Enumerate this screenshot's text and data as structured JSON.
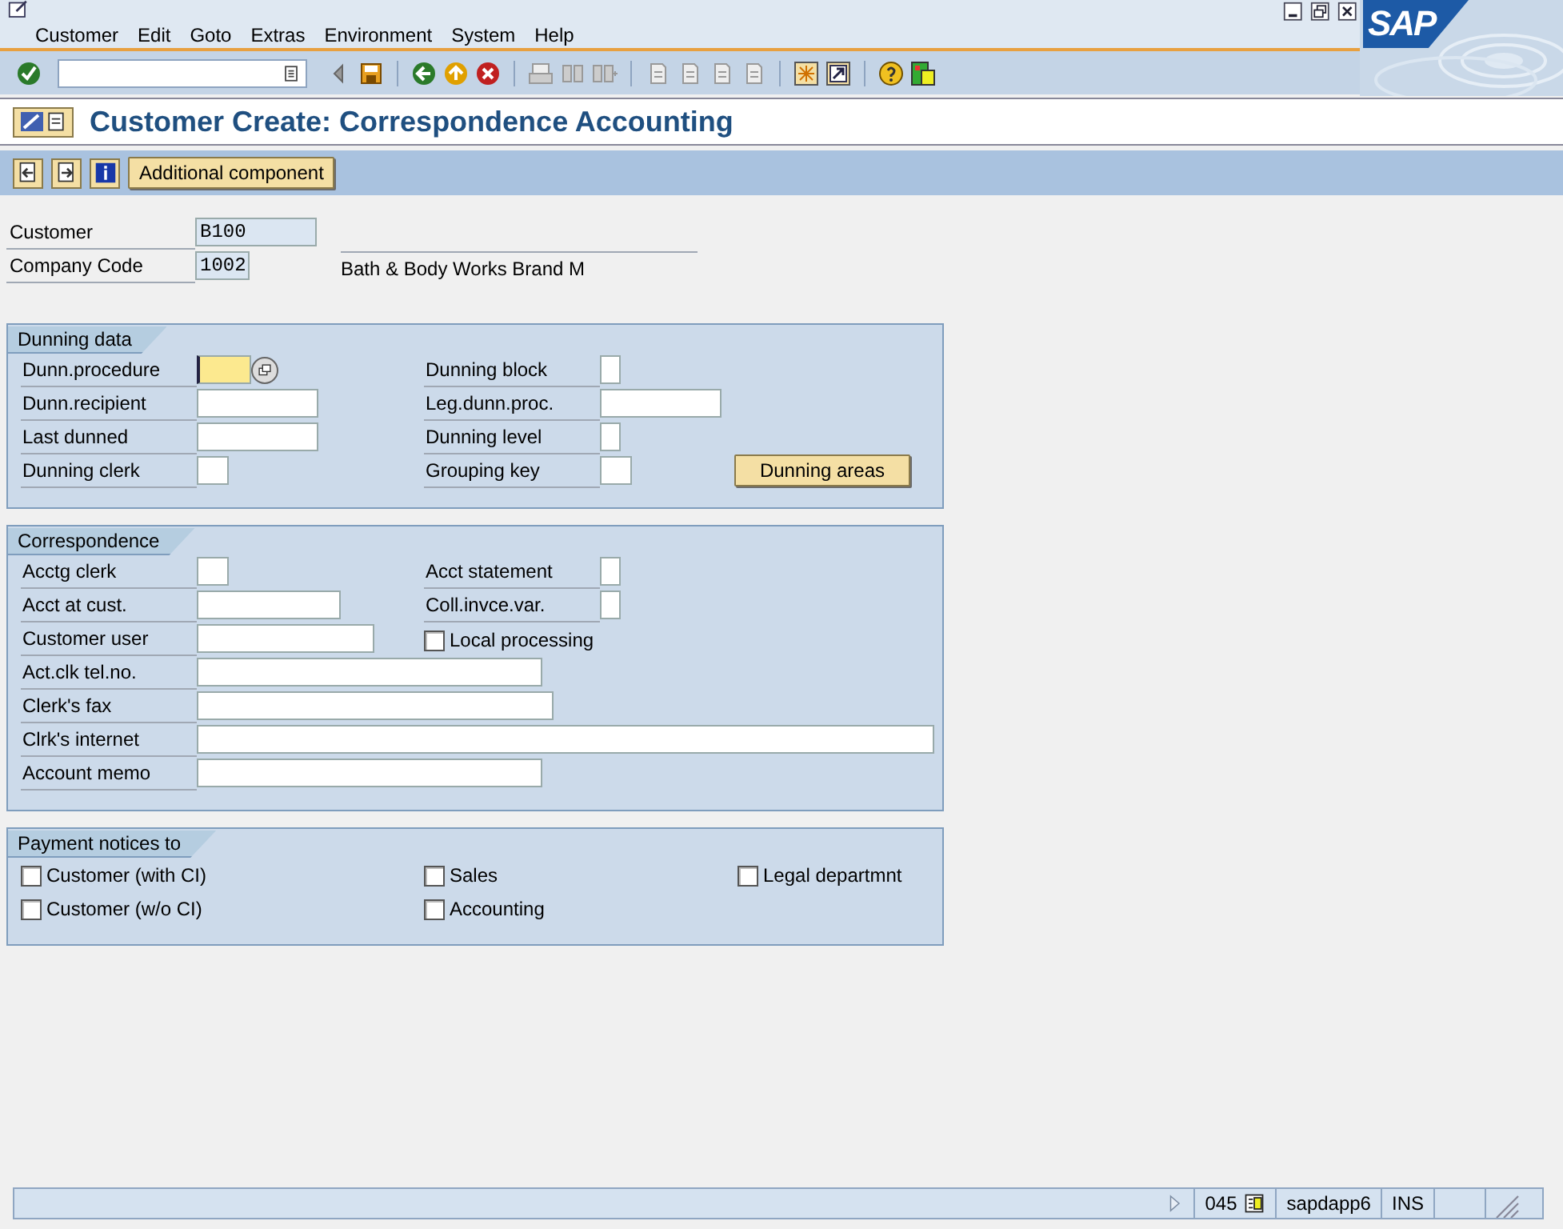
{
  "menu": [
    "Customer",
    "Edit",
    "Goto",
    "Extras",
    "Environment",
    "System",
    "Help"
  ],
  "logo": "SAP",
  "title": "Customer Create: Correspondence Accounting",
  "app_toolbar": {
    "button": "Additional component"
  },
  "header": [
    {
      "label": "Customer",
      "value": "B100"
    },
    {
      "label": "Company Code",
      "value": "1002",
      "description": "Bath & Body Works Brand M"
    }
  ],
  "sections": [
    {
      "title": "Dunning data",
      "rows": [
        {
          "left": {
            "kind": "input",
            "label": "Dunn.procedure",
            "focused": true,
            "help": true
          },
          "middle": {
            "kind": "input",
            "label": "Dunning block"
          }
        },
        {
          "left": {
            "kind": "input",
            "label": "Dunn.recipient"
          },
          "middle": {
            "kind": "input",
            "label": "Leg.dunn.proc."
          }
        },
        {
          "left": {
            "kind": "input",
            "label": "Last dunned"
          },
          "middle": {
            "kind": "input",
            "label": "Dunning level"
          }
        },
        {
          "left": {
            "kind": "input",
            "label": "Dunning clerk"
          },
          "middle": {
            "kind": "input",
            "label": "Grouping key"
          },
          "right": {
            "kind": "button",
            "label": "Dunning areas"
          }
        }
      ]
    },
    {
      "title": "Correspondence",
      "rows": [
        {
          "left": {
            "kind": "input",
            "label": "Acctg clerk"
          },
          "middle": {
            "kind": "input",
            "label": "Acct statement"
          }
        },
        {
          "left": {
            "kind": "input",
            "label": "Acct at cust."
          },
          "middle": {
            "kind": "input",
            "label": "Coll.invce.var."
          }
        },
        {
          "left": {
            "kind": "input",
            "label": "Customer user"
          },
          "middle": {
            "kind": "checkbox",
            "label": "Local processing",
            "checked": false
          }
        },
        {
          "left": {
            "kind": "input",
            "label": "Act.clk tel.no."
          }
        },
        {
          "left": {
            "kind": "input",
            "label": "Clerk's fax"
          }
        },
        {
          "left": {
            "kind": "input",
            "label": "Clrk's internet"
          }
        },
        {
          "left": {
            "kind": "input",
            "label": "Account memo"
          }
        }
      ]
    },
    {
      "title": "Payment notices to",
      "rows": [
        {
          "left": {
            "kind": "checkbox",
            "label": "Customer (with CI)",
            "checked": false
          },
          "middle": {
            "kind": "checkbox",
            "label": "Sales",
            "checked": false
          },
          "right": {
            "kind": "checkbox",
            "label": "Legal departmnt",
            "checked": false
          }
        },
        {
          "left": {
            "kind": "checkbox",
            "label": "Customer (w/o CI)",
            "checked": false
          },
          "middle": {
            "kind": "checkbox",
            "label": "Accounting",
            "checked": false
          }
        }
      ]
    }
  ],
  "status_bar": {
    "client": "045",
    "server": "sapdapp6",
    "mode": "INS"
  }
}
